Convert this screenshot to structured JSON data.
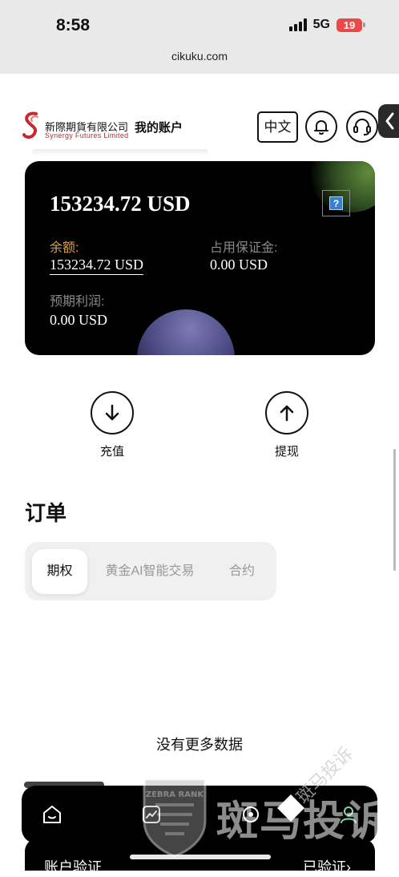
{
  "status_bar": {
    "time": "8:58",
    "network": "5G",
    "battery": "19",
    "url": "cikuku.com"
  },
  "header": {
    "logo_cn": "新際期貨有限公司",
    "logo_en": "Synergy Futures Limited",
    "title": "我的账户",
    "language_button": "中文",
    "icons": [
      "bell-icon",
      "headset-icon",
      "chevron-left-icon"
    ]
  },
  "account_card": {
    "total": "153234.72 USD",
    "balance_label": "余额:",
    "balance_value": "153234.72 USD",
    "margin_label": "占用保证金:",
    "margin_value": "0.00 USD",
    "expected_profit_label": "预期利润:",
    "expected_profit_value": "0.00 USD",
    "colors": {
      "card": "#000000",
      "balance_label": "#d8a24a"
    }
  },
  "actions": {
    "deposit_label": "充值",
    "withdraw_label": "提现"
  },
  "orders": {
    "title": "订单",
    "tabs": [
      {
        "label": "期权",
        "active": true
      },
      {
        "label": "黄金AI智能交易",
        "active": false
      },
      {
        "label": "合约",
        "active": false
      }
    ],
    "empty_text": "没有更多数据"
  },
  "bottom_nav": {
    "icons": [
      "home-icon",
      "chart-icon",
      "message-icon",
      "diamond-icon",
      "user-icon"
    ],
    "partial_left": "账户验证",
    "partial_right": "已验证›"
  },
  "watermark": {
    "text": "斑马投诉",
    "small_text": "斑马投诉",
    "badge_text": "ZEBRA RANK"
  }
}
